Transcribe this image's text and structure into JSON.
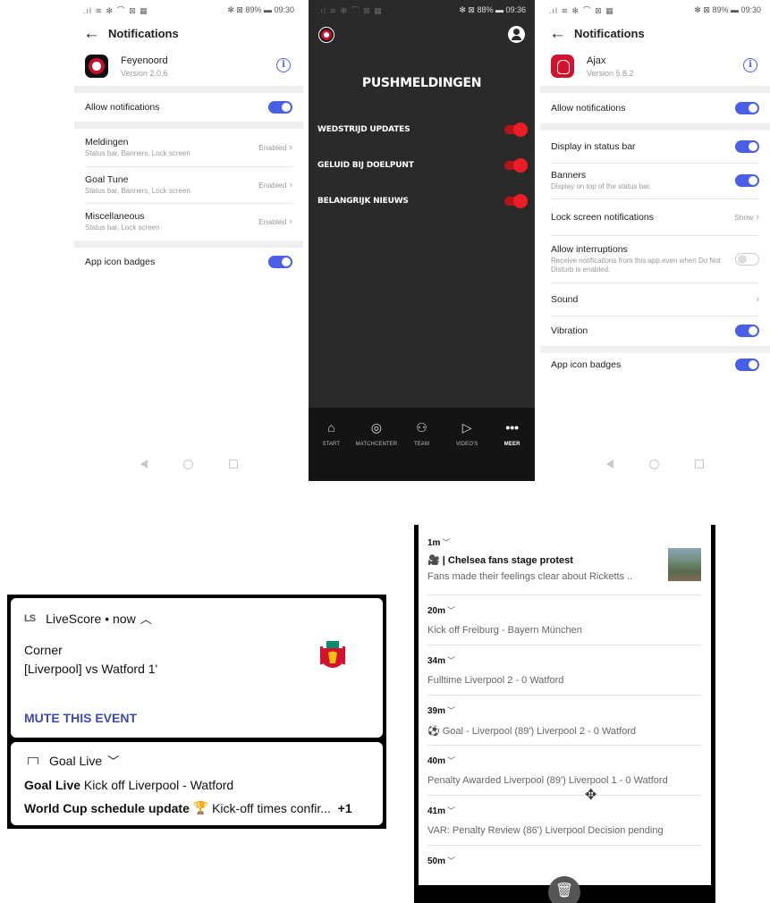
{
  "feyenoord_settings": {
    "status_bar": {
      "left": ".ıl ≋ ✻ ⌒ ⊠ ▦",
      "right": "✻ ⊠ 89% ▬ 09:30"
    },
    "header_title": "Notifications",
    "app": {
      "name": "Feyenoord",
      "version": "Version 2.0.6"
    },
    "allow_label": "Allow notifications",
    "channels": [
      {
        "name": "Meldingen",
        "desc": "Status bar, Banners, Lock screen",
        "value": "Enabled"
      },
      {
        "name": "Goal Tune",
        "desc": "Status bar, Banners, Lock screen",
        "value": "Enabled"
      },
      {
        "name": "Miscellaneous",
        "desc": "Status bar, Lock screen",
        "value": "Enabled"
      }
    ],
    "badges_label": "App icon badges"
  },
  "feyenoord_app": {
    "status_bar": {
      "left": ".ıl ≋ ✻ ⌒ ⊠ ▦",
      "right": "✻ ⊠ 88% ▬ 09:36"
    },
    "title": "PUSHMELDINGEN",
    "rows": [
      "WEDSTRIJD UPDATES",
      "GELUID BIJ DOELPUNT",
      "BELANGRIJK NIEUWS"
    ],
    "nav": [
      "START",
      "MATCHCENTER",
      "TEAM",
      "VIDEO'S",
      "MEER"
    ]
  },
  "ajax_settings": {
    "status_bar": {
      "left": ".ıl ≋ ✻ ⌒ ⊠ ▦",
      "right": "✻ ⊠ 89% ▬ 09:30"
    },
    "header_title": "Notifications",
    "app": {
      "name": "Ajax",
      "version": "Version 5.8.2"
    },
    "allow_label": "Allow notifications",
    "status_bar_label": "Display in status bar",
    "banners": {
      "label": "Banners",
      "desc": "Display on top of the status bar."
    },
    "lock_screen": {
      "label": "Lock screen notifications",
      "value": "Show"
    },
    "interruptions": {
      "label": "Allow interruptions",
      "desc": "Receive notifications from this app even when Do Not Disturb is enabled."
    },
    "sound_label": "Sound",
    "vibration_label": "Vibration",
    "badges_label": "App icon badges"
  },
  "livescore_notif": {
    "source": "LiveScore • now",
    "title": "Corner",
    "body": "[Liverpool] vs Watford 1'",
    "action": "MUTE THIS EVENT",
    "goal_source": "Goal Live",
    "line1_bold": "Goal Live",
    "line1_rest": "Kick off Liverpool - Watford",
    "line2_bold": "World Cup schedule update",
    "line2_emoji": "🏆",
    "line2_rest": "Kick-off times confir...",
    "more_count": "+1"
  },
  "feed": {
    "items": [
      {
        "time": "1m",
        "headline": "🎥 | Chelsea fans stage protest",
        "text": "Fans made their feelings clear about Ricketts .."
      },
      {
        "time": "20m",
        "text": "Kick off Freiburg - Bayern München"
      },
      {
        "time": "34m",
        "text": "Fulltime Liverpool 2 - 0 Watford"
      },
      {
        "time": "39m",
        "text": "⚽ Goal - Liverpool (89') Liverpool 2 - 0 Watford"
      },
      {
        "time": "40m",
        "text": "Penalty Awarded Liverpool (89') Liverpool 1 - 0 Watford"
      },
      {
        "time": "41m",
        "text": "VAR: Penalty Review (86') Liverpool Decision pending"
      },
      {
        "time": "50m"
      }
    ]
  }
}
